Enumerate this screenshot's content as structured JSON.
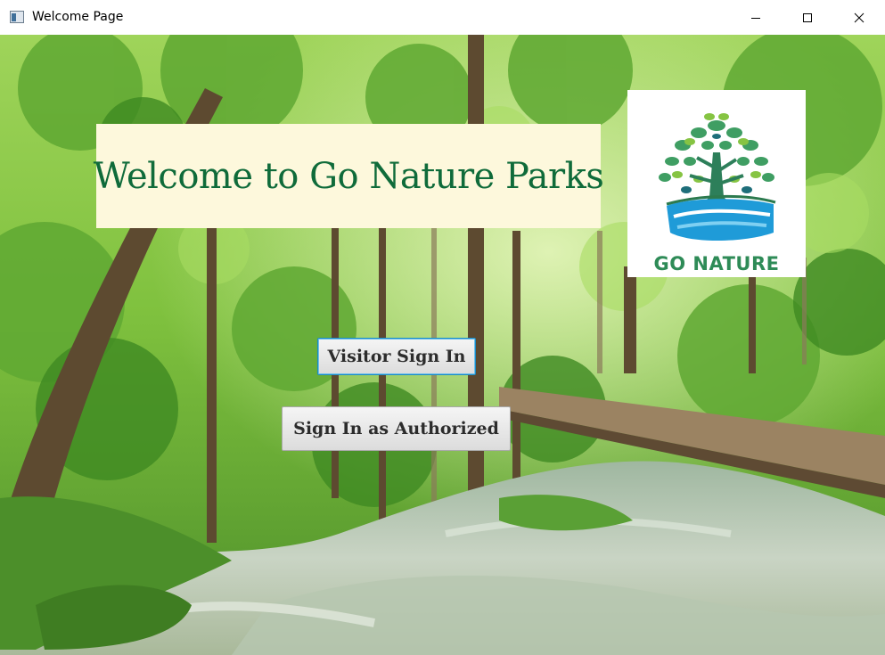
{
  "window": {
    "title": "Welcome Page",
    "controls": {
      "minimize": "minimize",
      "maximize": "maximize",
      "close": "close"
    }
  },
  "banner": {
    "heading": "Welcome to Go Nature Parks"
  },
  "logo": {
    "text": "GO NATURE",
    "icon": "tree-river-logo"
  },
  "buttons": {
    "visitor_label": "Visitor Sign In",
    "authorized_label": "Sign In as Authorized"
  },
  "colors": {
    "heading_text": "#0f6b3a",
    "banner_bg": "#fdf8dc",
    "logo_text": "#2e8b57",
    "focus_border": "#1a8cc7"
  }
}
